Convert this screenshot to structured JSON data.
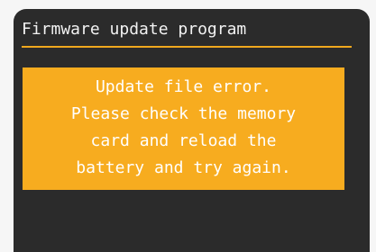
{
  "screen": {
    "title": "Firmware update program",
    "accent_color": "#f0a81e",
    "background_color": "#2b2b2b"
  },
  "error_dialog": {
    "panel_color": "#f7ac1f",
    "lines": [
      "Update file error.",
      "Please check the memory",
      "card and reload the",
      "battery and try again."
    ]
  }
}
